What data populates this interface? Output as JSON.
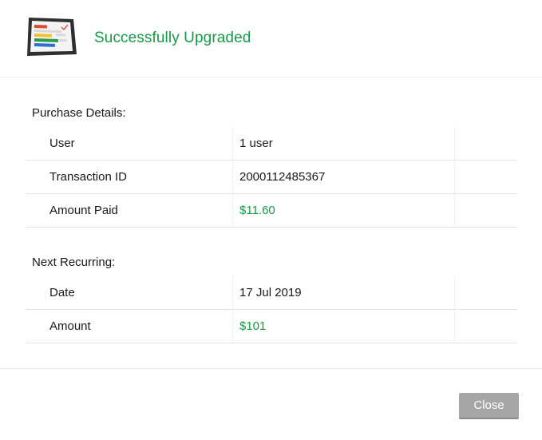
{
  "header": {
    "title": "Successfully Upgraded",
    "icon": "tablet-report-icon"
  },
  "purchase_details": {
    "title": "Purchase Details:",
    "rows": [
      {
        "label": "User",
        "value": "1 user"
      },
      {
        "label": "Transaction ID",
        "value": "2000112485367"
      },
      {
        "label": "Amount Paid",
        "value": "$11.60"
      }
    ]
  },
  "next_recurring": {
    "title": "Next Recurring:",
    "rows": [
      {
        "label": "Date",
        "value": "17 Jul 2019"
      },
      {
        "label": "Amount",
        "value": "$101"
      }
    ]
  },
  "footer": {
    "close_label": "Close"
  },
  "colors": {
    "accent_green": "#169a47",
    "button_gray": "#a6a6a6"
  }
}
